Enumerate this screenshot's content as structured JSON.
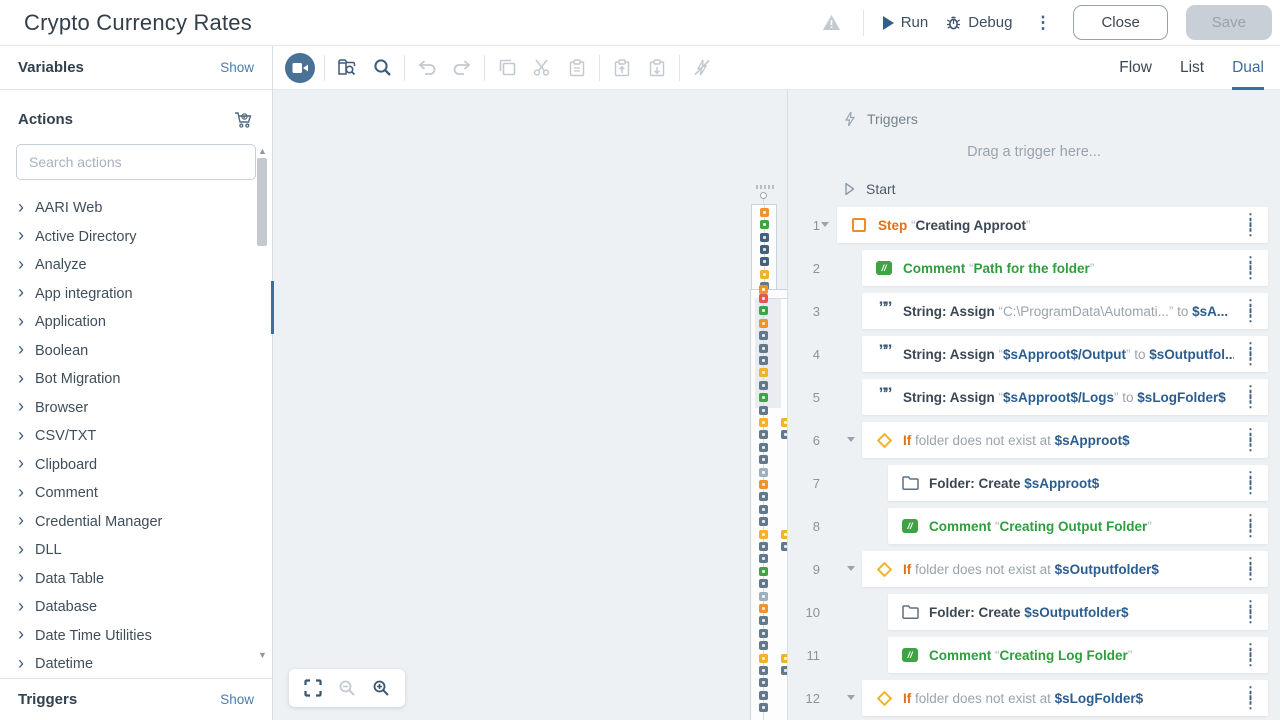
{
  "header": {
    "title": "Crypto Currency Rates",
    "run_label": "Run",
    "debug_label": "Debug",
    "close_label": "Close",
    "save_label": "Save"
  },
  "view_tabs": {
    "options": [
      "Flow",
      "List",
      "Dual"
    ],
    "active": "Dual"
  },
  "sidebar": {
    "variables": {
      "title": "Variables",
      "action": "Show"
    },
    "actions": {
      "title": "Actions",
      "search_placeholder": "Search actions",
      "items": [
        "AARI Web",
        "Active Directory",
        "Analyze",
        "App integration",
        "Application",
        "Boolean",
        "Bot Migration",
        "Browser",
        "CSV/TXT",
        "Clipboard",
        "Comment",
        "Credential Manager",
        "DLL",
        "Data Table",
        "Database",
        "Date Time Utilities",
        "Datetime"
      ]
    },
    "triggers": {
      "title": "Triggers",
      "action": "Show"
    }
  },
  "canvas": {
    "toolbar": [
      "record",
      "search-flow",
      "zoom",
      "undo",
      "redo",
      "copy",
      "cut",
      "paste",
      "copy-to-clipboard",
      "paste-from-clipboard",
      "trigger-disabled"
    ],
    "zoom_controls": [
      "fit-to-screen",
      "zoom-out",
      "zoom-in"
    ],
    "flow": {
      "top_sequence": [
        "step",
        "comment",
        "string",
        "string",
        "string",
        "if",
        "action",
        "comment",
        "if",
        "action",
        "comment",
        "if",
        "action"
      ],
      "main_sequence": [
        "try",
        "comment",
        "step",
        "action",
        "action",
        "action",
        "if",
        "action",
        "comment",
        "action",
        "if",
        "action",
        "action",
        "action",
        "end",
        "step",
        "action",
        "action",
        "action",
        "if",
        "action",
        "action",
        "comment",
        "action",
        "end",
        "step",
        "action",
        "action",
        "action",
        "if",
        "action",
        "action",
        "action",
        "action"
      ],
      "branch_indices": [
        10,
        19,
        29
      ],
      "catch_column": [
        "try",
        "if",
        "action",
        "action",
        "",
        "action",
        "action"
      ],
      "finally_column": [
        "try",
        "action"
      ]
    }
  },
  "list_panel": {
    "triggers_label": "Triggers",
    "drag_hint": "Drag a trigger here...",
    "start_label": "Start",
    "rows": [
      {
        "num": "1",
        "indent": 0,
        "chevron": true,
        "icon": "step",
        "parts": [
          {
            "t": "Step ",
            "s": "o"
          },
          {
            "t": "“",
            "s": "q"
          },
          {
            "t": "Creating Approot",
            "s": "b"
          },
          {
            "t": "”",
            "s": "q"
          }
        ]
      },
      {
        "num": "2",
        "indent": 1,
        "chevron": false,
        "icon": "comment",
        "parts": [
          {
            "t": "Comment ",
            "s": "g"
          },
          {
            "t": "“",
            "s": "q"
          },
          {
            "t": "Path for the folder",
            "s": "g"
          },
          {
            "t": "”",
            "s": "q"
          }
        ]
      },
      {
        "num": "3",
        "indent": 1,
        "chevron": false,
        "icon": "string",
        "parts": [
          {
            "t": "String: Assign ",
            "s": "b"
          },
          {
            "t": "“",
            "s": "q"
          },
          {
            "t": "C:\\ProgramData\\Automati...",
            "s": "gr"
          },
          {
            "t": "”",
            "s": "q"
          },
          {
            "t": " to ",
            "s": "gr"
          },
          {
            "t": "$sA...",
            "s": "bl"
          }
        ]
      },
      {
        "num": "4",
        "indent": 1,
        "chevron": false,
        "icon": "string",
        "parts": [
          {
            "t": "String: Assign ",
            "s": "b"
          },
          {
            "t": "“",
            "s": "q"
          },
          {
            "t": "$sApproot$/Output",
            "s": "bl"
          },
          {
            "t": "”",
            "s": "q"
          },
          {
            "t": " to ",
            "s": "gr"
          },
          {
            "t": "$sOutputfol...",
            "s": "bl"
          }
        ]
      },
      {
        "num": "5",
        "indent": 1,
        "chevron": false,
        "icon": "string",
        "parts": [
          {
            "t": "String: Assign ",
            "s": "b"
          },
          {
            "t": "“",
            "s": "q"
          },
          {
            "t": "$sApproot$/Logs",
            "s": "bl"
          },
          {
            "t": "”",
            "s": "q"
          },
          {
            "t": " to ",
            "s": "gr"
          },
          {
            "t": "$sLogFolder$",
            "s": "bl"
          }
        ]
      },
      {
        "num": "6",
        "indent": 1,
        "chevron": true,
        "icon": "if",
        "parts": [
          {
            "t": "If ",
            "s": "o"
          },
          {
            "t": "folder does not exist at ",
            "s": "gr"
          },
          {
            "t": "$sApproot$",
            "s": "bl"
          }
        ]
      },
      {
        "num": "7",
        "indent": 2,
        "chevron": false,
        "icon": "folder",
        "parts": [
          {
            "t": "Folder: Create ",
            "s": "b"
          },
          {
            "t": "$sApproot$",
            "s": "bl"
          }
        ]
      },
      {
        "num": "8",
        "indent": 2,
        "chevron": false,
        "icon": "comment",
        "parts": [
          {
            "t": "Comment ",
            "s": "g"
          },
          {
            "t": "“",
            "s": "q"
          },
          {
            "t": "Creating Output Folder",
            "s": "g"
          },
          {
            "t": "”",
            "s": "q"
          }
        ]
      },
      {
        "num": "9",
        "indent": 1,
        "chevron": true,
        "icon": "if",
        "parts": [
          {
            "t": "If ",
            "s": "o"
          },
          {
            "t": "folder does not exist at ",
            "s": "gr"
          },
          {
            "t": "$sOutputfolder$",
            "s": "bl"
          }
        ]
      },
      {
        "num": "10",
        "indent": 2,
        "chevron": false,
        "icon": "folder",
        "parts": [
          {
            "t": "Folder: Create ",
            "s": "b"
          },
          {
            "t": "$sOutputfolder$",
            "s": "bl"
          }
        ]
      },
      {
        "num": "11",
        "indent": 2,
        "chevron": false,
        "icon": "comment",
        "parts": [
          {
            "t": "Comment ",
            "s": "g"
          },
          {
            "t": "“",
            "s": "q"
          },
          {
            "t": "Creating Log Folder",
            "s": "g"
          },
          {
            "t": "”",
            "s": "q"
          }
        ]
      },
      {
        "num": "12",
        "indent": 1,
        "chevron": true,
        "icon": "if",
        "parts": [
          {
            "t": "If ",
            "s": "o"
          },
          {
            "t": "folder does not exist at ",
            "s": "gr"
          },
          {
            "t": "$sLogFolder$",
            "s": "bl"
          }
        ]
      }
    ]
  },
  "colors": {
    "accent_blue": "#3d6d9e",
    "link_blue": "#4a7dad",
    "orange": "#e1701a",
    "green": "#2f9e3f",
    "variable_blue": "#2c5d8f",
    "step_orange": "#f0932b",
    "if_yellow": "#f3b229",
    "error_red": "#e4574e",
    "canvas_bg": "#eef1f4"
  }
}
